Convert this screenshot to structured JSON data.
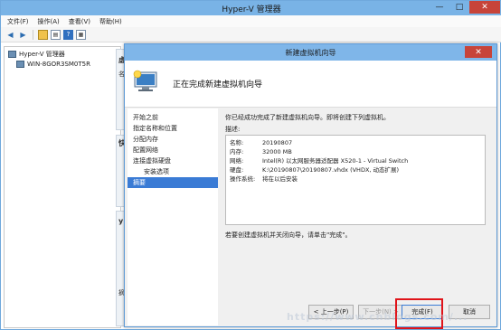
{
  "window": {
    "title": "Hyper-V 管理器",
    "minimize": "—",
    "maximize": "□",
    "close": "✕"
  },
  "menu": [
    "文件(F)",
    "操作(A)",
    "查看(V)",
    "帮助(H)"
  ],
  "tree": {
    "root": "Hyper-V 管理器",
    "server": "WIN-8GOR3SM0T5R"
  },
  "background_labels": [
    "虚",
    "名",
    "快",
    "y",
    "摘"
  ],
  "dialog": {
    "title": "新建虚拟机向导",
    "close": "✕",
    "heading": "正在完成新建虚拟机向导",
    "steps": [
      {
        "label": "开始之前"
      },
      {
        "label": "指定名称和位置"
      },
      {
        "label": "分配内存"
      },
      {
        "label": "配置网络"
      },
      {
        "label": "连接虚拟硬盘"
      },
      {
        "label": "安装选项"
      },
      {
        "label": "摘要"
      }
    ],
    "intro": "你已经成功完成了新建虚拟机向导。即将创建下列虚拟机。",
    "description_label": "描述:",
    "summary": [
      {
        "key": "名称:",
        "value": "20190807"
      },
      {
        "key": "内存:",
        "value": "32000 MB"
      },
      {
        "key": "网络:",
        "value": "Intel(R) 以太网服务器适配器 X520-1 - Virtual Switch"
      },
      {
        "key": "硬盘:",
        "value": "K:\\20190807\\20190807.vhdx (VHDX, 动态扩展)"
      },
      {
        "key": "操作系统:",
        "value": "将在以后安装"
      }
    ],
    "finish_note": "若要创建虚拟机并关闭向导，请单击\"完成\"。",
    "buttons": {
      "prev": "< 上一步(P)",
      "next": "下一步(N) >",
      "finish": "完成(F)",
      "cancel": "取消"
    }
  },
  "watermark": "https://www.cnblogs.com/...",
  "colors": {
    "accent": "#3a7bd5",
    "title_bar": "#7fb6e9",
    "close": "#c7443a",
    "highlight": "#e0141a"
  }
}
